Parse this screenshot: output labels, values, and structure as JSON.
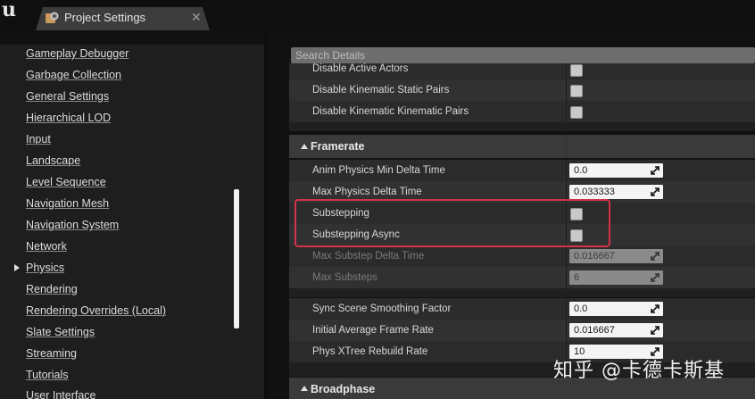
{
  "window": {
    "tab_title": "Project Settings",
    "tab_close": "✕",
    "logo": "u",
    "logo_icon": "unreal-logo",
    "tab_icon": "settings-icon"
  },
  "sidebar": {
    "items": [
      {
        "label": "Gameplay Debugger"
      },
      {
        "label": "Garbage Collection"
      },
      {
        "label": "General Settings"
      },
      {
        "label": "Hierarchical LOD"
      },
      {
        "label": "Input"
      },
      {
        "label": "Landscape"
      },
      {
        "label": "Level Sequence"
      },
      {
        "label": "Navigation Mesh"
      },
      {
        "label": "Navigation System"
      },
      {
        "label": "Network"
      },
      {
        "label": "Physics",
        "selected": true
      },
      {
        "label": "Rendering"
      },
      {
        "label": "Rendering Overrides (Local)"
      },
      {
        "label": "Slate Settings"
      },
      {
        "label": "Streaming"
      },
      {
        "label": "Tutorials"
      },
      {
        "label": "User Interface"
      }
    ]
  },
  "details": {
    "search_placeholder": "Search Details",
    "top_rows": [
      {
        "label": "Disable Active Actors",
        "type": "checkbox",
        "checked": false
      },
      {
        "label": "Disable Kinematic Static Pairs",
        "type": "checkbox",
        "checked": false
      },
      {
        "label": "Disable Kinematic Kinematic Pairs",
        "type": "checkbox",
        "checked": false
      }
    ],
    "framerate": {
      "title": "Framerate",
      "rows": [
        {
          "label": "Anim Physics Min Delta Time",
          "type": "number",
          "value": "0.0"
        },
        {
          "label": "Max Physics Delta Time",
          "type": "number",
          "value": "0.033333"
        },
        {
          "label": "Substepping",
          "type": "checkbox",
          "checked": false
        },
        {
          "label": "Substepping Async",
          "type": "checkbox",
          "checked": false
        },
        {
          "label": "Max Substep Delta Time",
          "type": "number",
          "value": "0.016667",
          "disabled": true
        },
        {
          "label": "Max Substeps",
          "type": "number",
          "value": "6",
          "disabled": true
        }
      ],
      "rows2": [
        {
          "label": "Sync Scene Smoothing Factor",
          "type": "number",
          "value": "0.0"
        },
        {
          "label": "Initial Average Frame Rate",
          "type": "number",
          "value": "0.016667"
        },
        {
          "label": "Phys XTree Rebuild Rate",
          "type": "number",
          "value": "10"
        }
      ]
    },
    "broadphase": {
      "title": "Broadphase"
    }
  },
  "highlight_color": "#d4314a",
  "watermark": "知乎 @卡德卡斯基"
}
